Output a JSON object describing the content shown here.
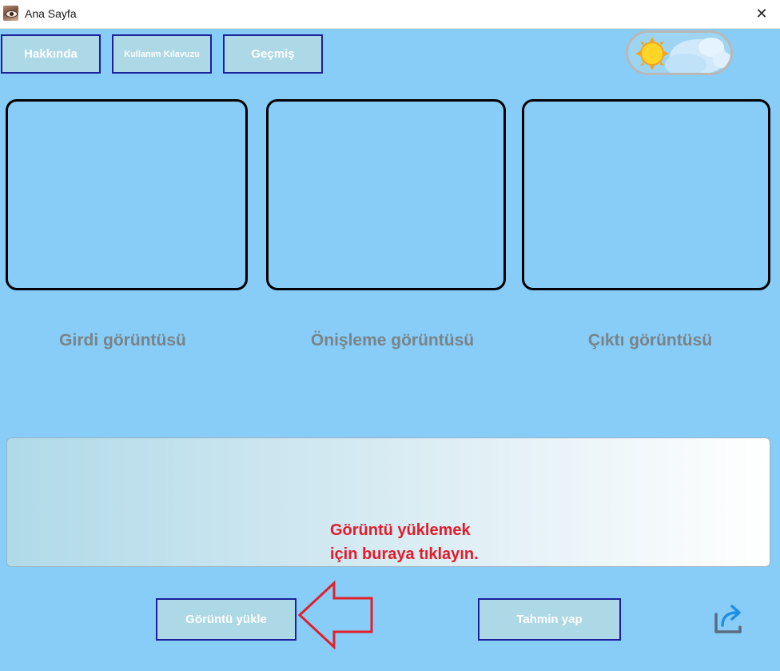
{
  "window": {
    "title": "Ana Sayfa",
    "close_glyph": "✕"
  },
  "toolbar": {
    "about_label": "Hakkında",
    "guide_label": "Kullanım Kılavuzu",
    "history_label": "Geçmiş"
  },
  "theme_toggle": {
    "state": "light",
    "icon": "sun-cloud-icon"
  },
  "panels": {
    "input_caption": "Girdi görüntüsü",
    "preview_caption": "Önişleme görüntüsü",
    "output_caption": "Çıktı görüntüsü"
  },
  "upload_area": {
    "hint": "Görüntü yüklemek\niçin buraya tıklayın."
  },
  "actions": {
    "upload_label": "Görüntü yükle",
    "predict_label": "Tahmin yap"
  },
  "colors": {
    "background": "#87cdf8",
    "button_fill": "#add8e6",
    "button_border": "#1b1f9b",
    "hint_text": "#e01c2a",
    "caption_text": "#7a8387"
  },
  "icons": {
    "app": "eye-icon",
    "close": "close-icon",
    "annotation": "arrow-left-annotation",
    "share": "share-icon"
  }
}
